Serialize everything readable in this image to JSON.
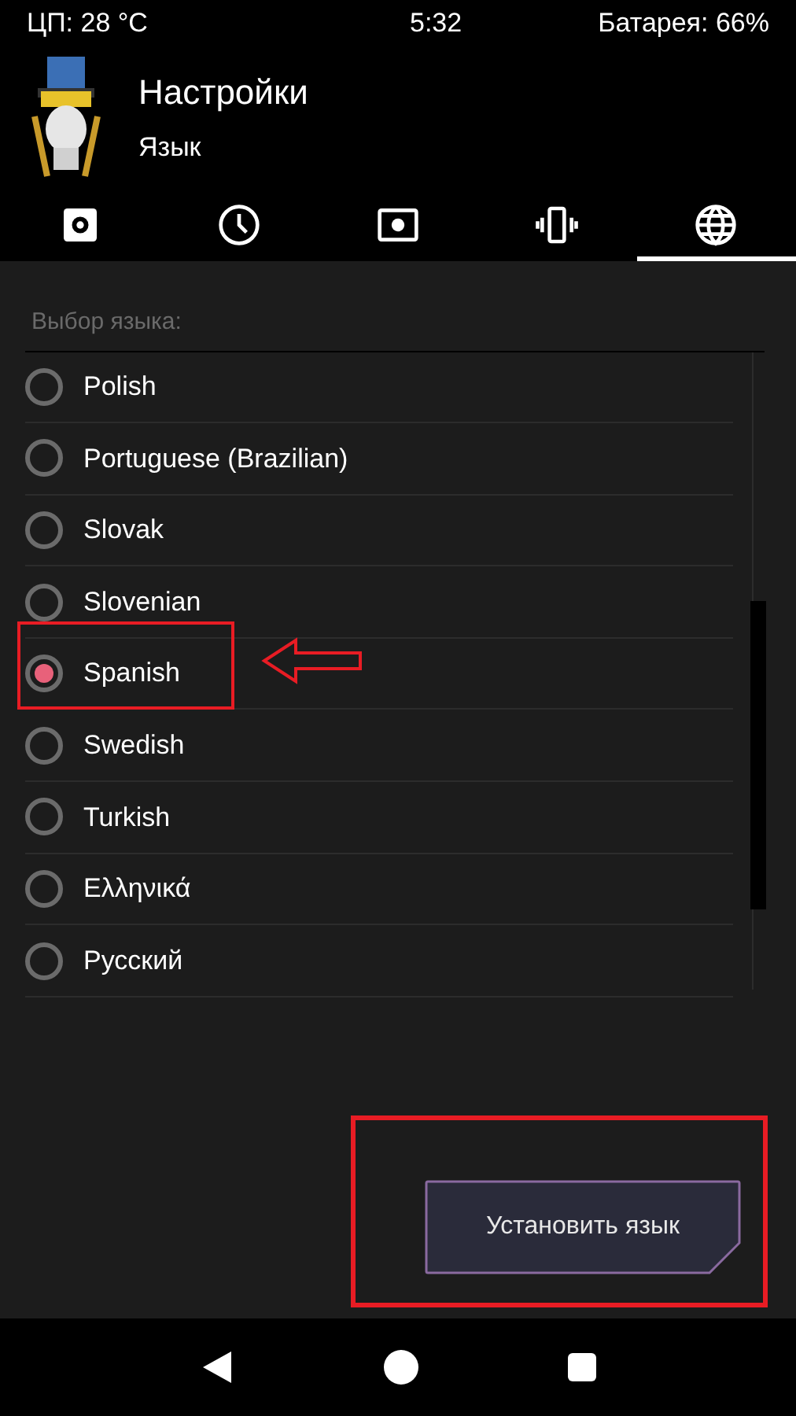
{
  "status_bar": {
    "cpu": "ЦП: 28 °C",
    "time": "5:32",
    "battery": "Батарея: 66%"
  },
  "header": {
    "title": "Настройки",
    "subtitle": "Язык"
  },
  "tabs": [
    {
      "kind": "gear",
      "selected": false
    },
    {
      "kind": "clock",
      "selected": false
    },
    {
      "kind": "brightness",
      "selected": false
    },
    {
      "kind": "vibrate",
      "selected": false
    },
    {
      "kind": "globe",
      "selected": true
    }
  ],
  "language_list": {
    "label": "Выбор языка:",
    "items": [
      {
        "label": "Polish",
        "selected": false
      },
      {
        "label": "Portuguese (Brazilian)",
        "selected": false
      },
      {
        "label": "Slovak",
        "selected": false
      },
      {
        "label": "Slovenian",
        "selected": false
      },
      {
        "label": "Spanish",
        "selected": true
      },
      {
        "label": "Swedish",
        "selected": false
      },
      {
        "label": "Turkish",
        "selected": false
      },
      {
        "label": "Ελληνικά",
        "selected": false
      },
      {
        "label": "Русский",
        "selected": false
      }
    ]
  },
  "apply_button": {
    "label": "Установить язык"
  }
}
